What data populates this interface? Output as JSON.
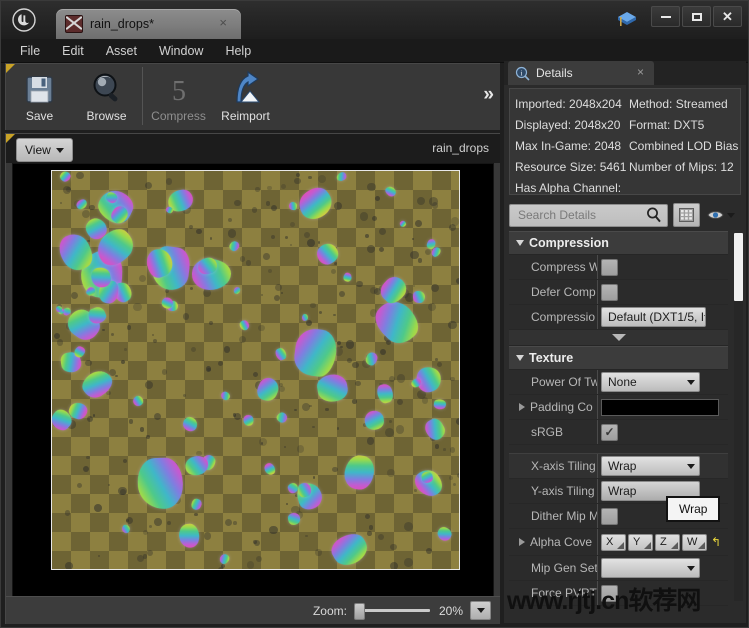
{
  "window": {
    "logo": "unreal-engine-logo",
    "minimize_label": "minimize",
    "maximize_label": "maximize",
    "close_label": "close"
  },
  "tab": {
    "label": "rain_drops*",
    "close": "×"
  },
  "menu": {
    "items": [
      "File",
      "Edit",
      "Asset",
      "Window",
      "Help"
    ]
  },
  "toolbar": {
    "buttons": [
      {
        "label": "Save",
        "icon": "floppy-disk-icon",
        "enabled": true
      },
      {
        "label": "Browse",
        "icon": "magnifier-icon",
        "enabled": true
      },
      {
        "label": "Compress",
        "icon": "compress-icon",
        "enabled": false
      },
      {
        "label": "Reimport",
        "icon": "reimport-arrow-icon",
        "enabled": true
      }
    ],
    "overflow": "»"
  },
  "viewport": {
    "view_button": "View",
    "title": "rain_drops",
    "zoom_label": "Zoom:",
    "zoom_value": "20%",
    "zoom_percent": 20
  },
  "details": {
    "tab_label": "Details",
    "tab_close": "×",
    "info": [
      {
        "left": "Imported: 2048x204",
        "right": "Method: Streamed"
      },
      {
        "left": "Displayed: 2048x20",
        "right": "Format: DXT5"
      },
      {
        "left": "Max In-Game: 2048",
        "right": "Combined LOD Bias"
      },
      {
        "left": "Resource Size: 5461",
        "right": "Number of Mips: 12"
      },
      {
        "left": "Has Alpha Channel:",
        "right": ""
      }
    ],
    "search": {
      "placeholder": "Search Details",
      "value": ""
    },
    "grid_button": "grid-view-button",
    "eye_button": "visibility-button",
    "categories": [
      {
        "title": "Compression",
        "rows": [
          {
            "name": "Compress W",
            "type": "checkbox",
            "checked": false
          },
          {
            "name": "Defer Comp",
            "type": "checkbox",
            "checked": false
          },
          {
            "name": "Compressio",
            "type": "combo",
            "value": "Default (DXT1/5, I"
          }
        ]
      },
      {
        "title": "Texture",
        "rows": [
          {
            "name": "Power Of Tw",
            "type": "combo",
            "value": "None"
          },
          {
            "name": "Padding Co",
            "type": "color",
            "value": "#000000",
            "expandable": true
          },
          {
            "name": "sRGB",
            "type": "checkbox",
            "checked": true
          },
          {
            "name": "X-axis Tiling",
            "type": "combo",
            "value": "Wrap"
          },
          {
            "name": "Y-axis Tiling",
            "type": "combo-flat",
            "value": "Wrap"
          },
          {
            "name": "Dither Mip M",
            "type": "checkbox",
            "checked": false
          },
          {
            "name": "Alpha Cove",
            "type": "vector4",
            "expandable": true,
            "components": [
              "X",
              "Y",
              "Z",
              "W"
            ],
            "reset": "↰"
          },
          {
            "name": "Mip Gen Set",
            "type": "combo",
            "value": ""
          },
          {
            "name": "Force PVRT",
            "type": "checkbox",
            "checked": false
          }
        ]
      }
    ],
    "tooltip": "Wrap"
  },
  "watermark": "www.rjtj.cn软荐网",
  "colors": {
    "accent_yellow": "#c8a227",
    "panel_bg": "#2b2b2b",
    "toolbar_bg": "#383838",
    "canvas_bg": "#000000",
    "checker_light": "#8d8040",
    "checker_dark": "#6e6434"
  }
}
